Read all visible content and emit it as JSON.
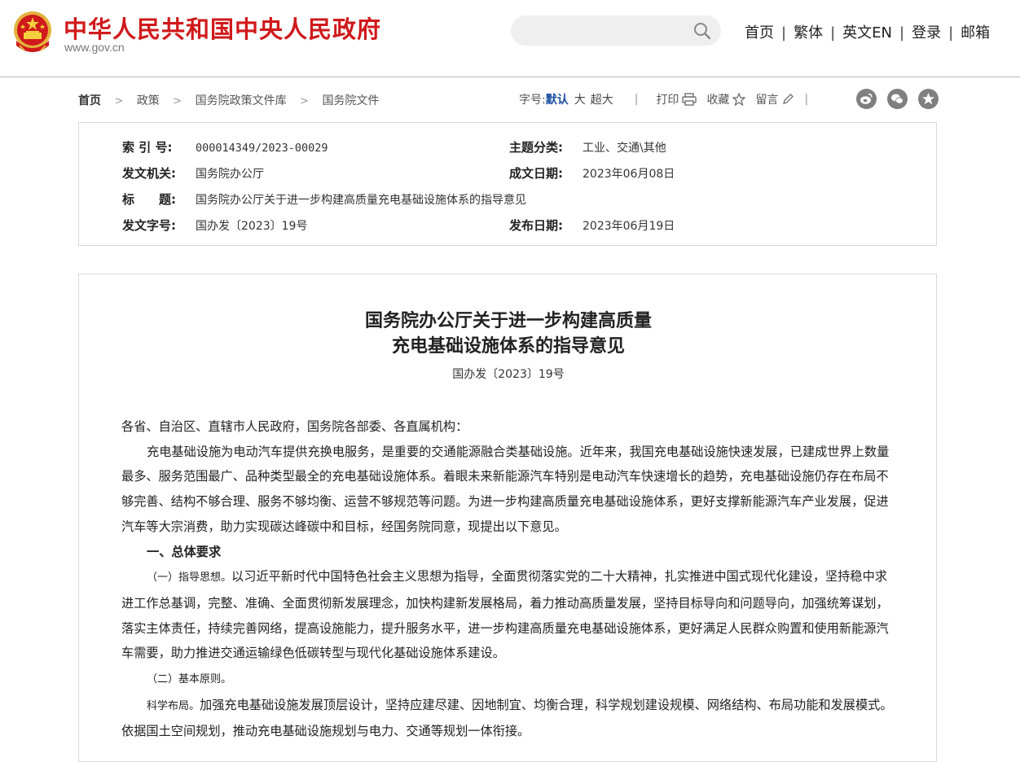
{
  "header": {
    "site_title": "中华人民共和国中央人民政府",
    "site_url": "www.gov.cn",
    "search_placeholder": "",
    "nav": [
      "首页",
      "繁体",
      "英文EN",
      "登录",
      "邮箱"
    ],
    "brand_color": "#d0191b"
  },
  "breadcrumb": [
    "首页",
    "政策",
    "国务院政策文件库",
    "国务院文件"
  ],
  "toolbar": {
    "font_size_label": "字号:",
    "font_default": "默认",
    "font_large": "大",
    "font_xlarge": "超大",
    "print": "打印",
    "favorite": "收藏",
    "comment": "留言",
    "share_icons": [
      "weibo-icon",
      "wechat-icon",
      "star-icon"
    ]
  },
  "meta": {
    "index_label": "索 引 号:",
    "index_value": "000014349/2023-00029",
    "category_label": "主题分类:",
    "category_value": "工业、交通\\其他",
    "issuer_label": "发文机关:",
    "issuer_value": "国务院办公厅",
    "written_label": "成文日期:",
    "written_value": "2023年06月08日",
    "title_label": "标　　题:",
    "title_value": "国务院办公厅关于进一步构建高质量充电基础设施体系的指导意见",
    "docno_label": "发文字号:",
    "docno_value": "国办发〔2023〕19号",
    "published_label": "发布日期:",
    "published_value": "2023年06月19日"
  },
  "article": {
    "title_line1": "国务院办公厅关于进一步构建高质量",
    "title_line2": "充电基础设施体系的指导意见",
    "doc_no": "国办发〔2023〕19号",
    "salutation": "各省、自治区、直辖市人民政府，国务院各部委、各直属机构：",
    "p1": "充电基础设施为电动汽车提供充换电服务，是重要的交通能源融合类基础设施。近年来，我国充电基础设施快速发展，已建成世界上数量最多、服务范围最广、品种类型最全的充电基础设施体系。着眼未来新能源汽车特别是电动汽车快速增长的趋势，充电基础设施仍存在布局不够完善、结构不够合理、服务不够均衡、运营不够规范等问题。为进一步构建高质量充电基础设施体系，更好支撑新能源汽车产业发展，促进汽车等大宗消费，助力实现碳达峰碳中和目标，经国务院同意，现提出以下意见。",
    "section1": "一、总体要求",
    "p2_lead": "（一）指导思想。",
    "p2": "以习近平新时代中国特色社会主义思想为指导，全面贯彻落实党的二十大精神，扎实推进中国式现代化建设，坚持稳中求进工作总基调，完整、准确、全面贯彻新发展理念，加快构建新发展格局，着力推动高质量发展，坚持目标导向和问题导向，加强统筹谋划，落实主体责任，持续完善网络，提高设施能力，提升服务水平，进一步构建高质量充电基础设施体系，更好满足人民群众购置和使用新能源汽车需要，助力推进交通运输绿色低碳转型与现代化基础设施体系建设。",
    "p3_lead": "（二）基本原则。",
    "p4_lead": "科学布局。",
    "p4": "加强充电基础设施发展顶层设计，坚持应建尽建、因地制宜、均衡合理，科学规划建设规模、网络结构、布局功能和发展模式。依据国土空间规划，推动充电基础设施规划与电力、交通等规划一体衔接。"
  }
}
